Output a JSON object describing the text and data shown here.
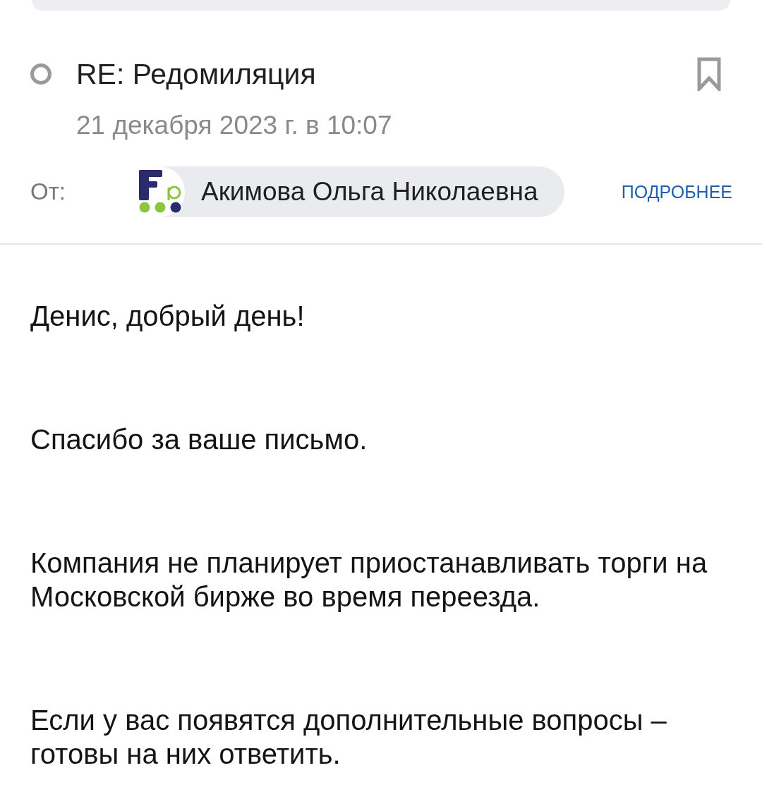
{
  "message": {
    "unread": false,
    "subject": "RE: Редомиляция",
    "bookmarked": false,
    "date": "21 декабря 2023 г. в 10:07",
    "from_label": "От:",
    "sender": {
      "name": "Акимова Ольга Николаевна"
    },
    "details_link": "ПОДРОБНЕЕ"
  },
  "body": {
    "paragraphs": [
      "Денис, добрый день!",
      "Спасибо за ваше письмо.",
      "Компания не планирует приостанавливать торги на Московской бирже во время переезда.",
      "Если у вас появятся дополнительные вопросы – готовы на них ответить."
    ]
  }
}
